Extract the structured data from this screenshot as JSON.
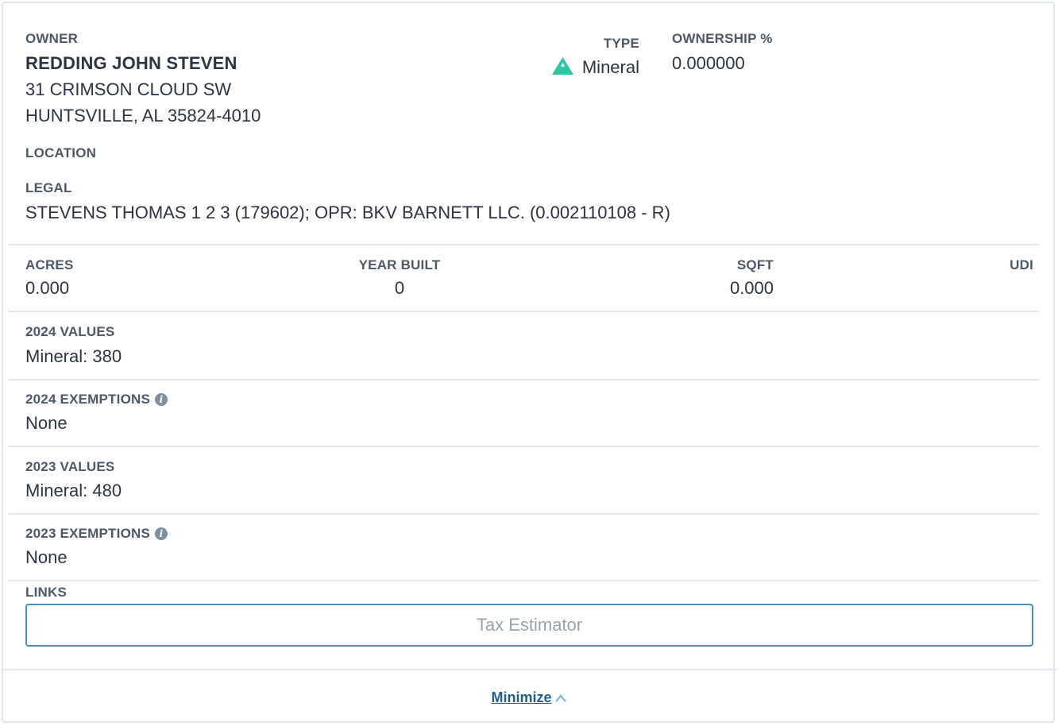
{
  "owner": {
    "label": "OWNER",
    "name": "REDDING JOHN STEVEN",
    "address_line1": "31 CRIMSON CLOUD SW",
    "address_line2": "HUNTSVILLE, AL 35824-4010"
  },
  "type": {
    "label": "TYPE",
    "value": "Mineral",
    "icon": "mineral-mountain-icon",
    "icon_color": "#2ec4a6"
  },
  "ownership": {
    "label": "OWNERSHIP %",
    "value": "0.000000"
  },
  "location": {
    "label": "LOCATION"
  },
  "legal": {
    "label": "LEGAL",
    "value": "STEVENS THOMAS 1 2 3 (179602); OPR: BKV BARNETT LLC. (0.002110108 - R)"
  },
  "stats": {
    "acres": {
      "label": "ACRES",
      "value": "0.000"
    },
    "year_built": {
      "label": "YEAR BUILT",
      "value": "0"
    },
    "sqft": {
      "label": "SQFT",
      "value": "0.000"
    },
    "udi": {
      "label": "UDI"
    }
  },
  "values_2024": {
    "label": "2024 VALUES",
    "value": "Mineral: 380"
  },
  "exemptions_2024": {
    "label": "2024 EXEMPTIONS",
    "value": "None"
  },
  "values_2023": {
    "label": "2023 VALUES",
    "value": "Mineral: 480"
  },
  "exemptions_2023": {
    "label": "2023 EXEMPTIONS",
    "value": "None"
  },
  "links": {
    "label": "LINKS",
    "tax_estimator_label": "Tax Estimator"
  },
  "footer": {
    "minimize_label": "Minimize"
  },
  "colors": {
    "accent": "#1f5f8b",
    "button_border": "#4a90b5",
    "divider": "#e4e8ec"
  }
}
